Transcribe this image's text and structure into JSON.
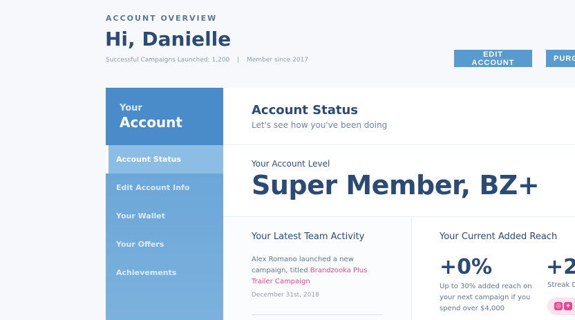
{
  "header": {
    "overview_label": "ACCOUNT OVERVIEW",
    "greeting": "Hi, Danielle",
    "campaigns_launched": "Successful Campaigns Launched: 1,200",
    "separator": "|",
    "member_since": "Member since 2017",
    "edit_account_label": "EDIT ACCOUNT",
    "purchase_label": "PURC"
  },
  "sidebar": {
    "title_small": "Your",
    "title_big": "Account",
    "items": [
      {
        "label": "Account Status",
        "active": true
      },
      {
        "label": "Edit Account Info",
        "active": false
      },
      {
        "label": "Your Wallet",
        "active": false
      },
      {
        "label": "Your Offers",
        "active": false
      },
      {
        "label": "Achievements",
        "active": false
      }
    ]
  },
  "main": {
    "status_title": "Account Status",
    "status_subtitle": "Let's see how you've been doing",
    "level_label": "Your Account Level",
    "level_value": "Super Member, BZ+",
    "activity": {
      "title": "Your Latest Team Activity",
      "text_prefix": "Alex Romano launched a new campaign, titled",
      "campaign_link": "Brandzooka Plus Trailer Campaign",
      "date": "December 31st, 2018"
    },
    "reach": {
      "title": "Your Current Added Reach",
      "value": "+0%",
      "description": "Up to 30% added reach on your next campaign if you spend over $4,000",
      "streak_value": "+2",
      "streak_label": "Streak D"
    }
  },
  "colors": {
    "accent": "#5a9bcf",
    "sidebar": "#4a8cc9",
    "title_text": "#2b4b75",
    "link": "#e04a8a"
  },
  "icons": {
    "fab_icons": [
      "instagram-icon",
      "plus-icon"
    ]
  }
}
